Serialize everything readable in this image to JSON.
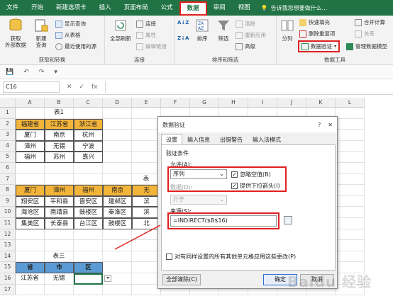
{
  "ribbon_tabs": [
    "文件",
    "开始",
    "新建选项卡",
    "插入",
    "页面布局",
    "公式",
    "数据",
    "审阅",
    "视图"
  ],
  "active_tab": "数据",
  "tell_me": "告诉我您想要做什么...",
  "groups": {
    "get_transform": {
      "label": "获取和转换",
      "get_external": "获取\n外部数据",
      "new_query": "新建\n查询",
      "show_queries": "显示查询",
      "from_table": "从表格",
      "recent_sources": "最近使用的源"
    },
    "connections": {
      "label": "连接",
      "refresh_all": "全部刷新",
      "connections": "连接",
      "properties": "属性",
      "edit_links": "编辑链接"
    },
    "sort_filter": {
      "label": "排序和筛选",
      "sort": "排序",
      "filter": "筛选",
      "clear": "清除",
      "reapply": "重新应用",
      "advanced": "高级"
    },
    "data_tools": {
      "label": "数据工具",
      "text_to_columns": "分列",
      "flash_fill": "快速填充",
      "remove_duplicates": "删除重复项",
      "data_validation": "数据验证",
      "consolidate": "合并计算",
      "relationships": "关系",
      "manage_model": "管理数据模型"
    }
  },
  "namebox": "C16",
  "fx": "fx",
  "columns": [
    "A",
    "B",
    "C",
    "D",
    "E",
    "F",
    "G",
    "H",
    "I",
    "J",
    "K",
    "L"
  ],
  "rows": [
    "1",
    "2",
    "3",
    "4",
    "5",
    "6",
    "7",
    "8",
    "9",
    "10",
    "11",
    "12",
    "13",
    "14",
    "15",
    "16",
    "17"
  ],
  "table1": {
    "title": "表1",
    "headers": [
      "福建省",
      "江苏省",
      "浙江省"
    ],
    "rows": [
      [
        "厦门",
        "南京",
        "杭州"
      ],
      [
        "漳州",
        "无锡",
        "宁波"
      ],
      [
        "福州",
        "苏州",
        "嘉兴"
      ]
    ]
  },
  "table2": {
    "title": "表",
    "headers": [
      "厦门",
      "漳州",
      "福州",
      "南京",
      "无"
    ],
    "rows": [
      [
        "翔安区",
        "平和县",
        "晋安区",
        "建邺区",
        "滨"
      ],
      [
        "海沧区",
        "南靖县",
        "鼓楼区",
        "秦淮区",
        "滨"
      ],
      [
        "集美区",
        "长泰县",
        "台江区",
        "鼓楼区",
        "北"
      ]
    ]
  },
  "table3": {
    "title": "表三",
    "headers": [
      "省",
      "市",
      "区"
    ],
    "row": [
      "江苏省",
      "无锡",
      ""
    ]
  },
  "dialog": {
    "title": "数据验证",
    "help": "?",
    "close": "✕",
    "tabs": [
      "设置",
      "输入信息",
      "出错警告",
      "输入法模式"
    ],
    "criteria_label": "验证条件",
    "allow_label": "允许(A):",
    "allow_value": "序列",
    "ignore_blank": "忽略空值(B)",
    "dropdown": "提供下拉箭头(I)",
    "data_label": "数据(D):",
    "data_value": "介于",
    "source_label": "来源(S):",
    "source_value": "=INDIRECT($B$16)",
    "apply_all": "对有同样设置的所有其他单元格应用这些更改(P)",
    "clear_all": "全部清除(C)",
    "ok": "确定",
    "cancel": "取消"
  },
  "watermark": "Baidu 经验",
  "colors": {
    "ribbon": "#217346",
    "highlight": "#e02020",
    "orange": "#f3b43a",
    "blue": "#5b9bd5"
  }
}
